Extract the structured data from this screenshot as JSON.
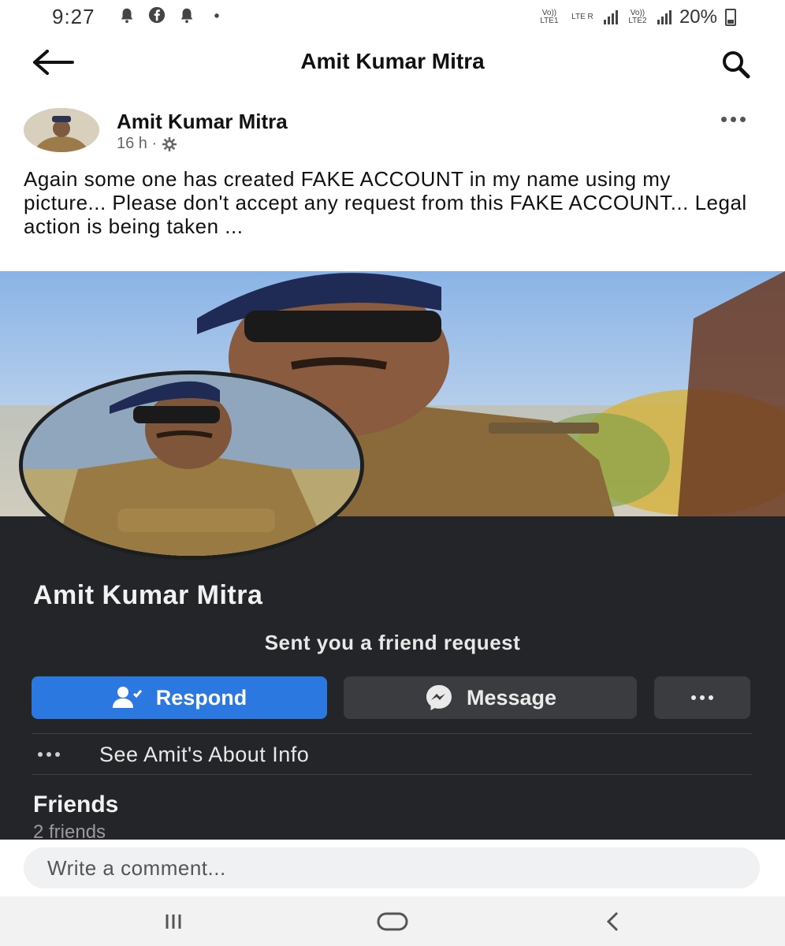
{
  "status_bar": {
    "time": "9:27",
    "left_icons": [
      "notification-bell-icon",
      "facebook-icon",
      "notification-bell-icon",
      "dot-icon"
    ],
    "sim1_label": "Vo)) LTE1",
    "sim1_type": "LTE R",
    "sim2_label": "Vo)) LTE2",
    "battery": "20%"
  },
  "app_bar": {
    "title": "Amit Kumar Mitra",
    "back_icon": "back-arrow-icon",
    "search_icon": "search-icon"
  },
  "post": {
    "author": "Amit Kumar Mitra",
    "time": "16 h ·",
    "privacy_icon": "gear-icon",
    "text": "Again some one has created FAKE ACCOUNT in my name using my picture... Please don't accept any request from this FAKE ACCOUNT... Legal action is being taken ..."
  },
  "profile_card": {
    "name": "Amit Kumar Mitra",
    "subtitle": "Sent you a friend request",
    "respond_label": "Respond",
    "message_label": "Message",
    "about_label": "See Amit's About Info",
    "friends_title": "Friends",
    "friends_count": "2 friends"
  },
  "comment": {
    "placeholder": "Write a comment..."
  },
  "colors": {
    "accent": "#2a78e0",
    "card_bg": "#232528",
    "button_dark": "#3a3c3f"
  }
}
